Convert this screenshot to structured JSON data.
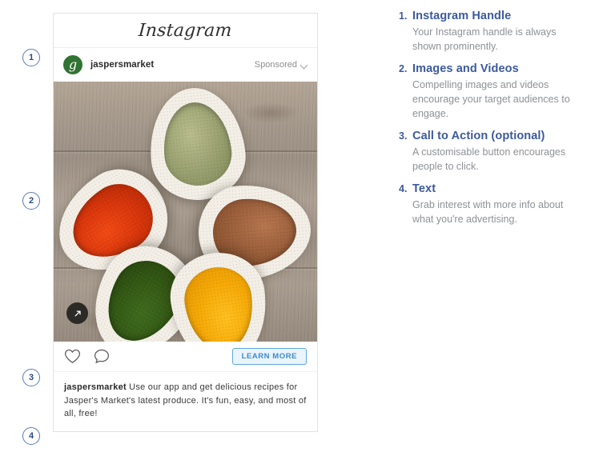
{
  "markers": [
    {
      "number": "1"
    },
    {
      "number": "2"
    },
    {
      "number": "3"
    },
    {
      "number": "4"
    }
  ],
  "card": {
    "wordmark": "Instagram",
    "avatar_letter": "g",
    "handle": "jaspersmarket",
    "sponsored_label": "Sponsored",
    "caret_icon": "chevron-down-icon",
    "photo": {
      "alt": "five teardrop bowls of colourful spices on weathered wood",
      "expand_icon": "expand-arrow-icon",
      "bowls": [
        {
          "name": "red-paprika-bowl"
        },
        {
          "name": "green-herb-bowl"
        },
        {
          "name": "brown-seed-bowl"
        },
        {
          "name": "dark-green-herb-bowl"
        },
        {
          "name": "yellow-turmeric-bowl"
        }
      ]
    },
    "actions": {
      "like_icon": "heart-icon",
      "comment_icon": "comment-bubble-icon",
      "cta_label": "LEARN MORE"
    },
    "caption": {
      "handle": "jaspersmarket",
      "text": " Use our app and get delicious recipes for Jasper's Market's latest produce. It's fun, easy, and most of all, free!"
    }
  },
  "legend": {
    "items": [
      {
        "number": "1.",
        "title": "Instagram Handle",
        "body": "Your Instagram handle is always shown prominently."
      },
      {
        "number": "2.",
        "title": "Images and Videos",
        "body": "Compelling images and videos encourage your target audiences to engage."
      },
      {
        "number": "3.",
        "title": "Call to Action (optional)",
        "body": "A customisable button encourages people to click."
      },
      {
        "number": "4.",
        "title": "Text",
        "body": "Grab interest with more info about what you're advertising."
      }
    ]
  },
  "colors": {
    "legend_heading": "#3c5a9a",
    "legend_body": "#8e9196",
    "marker_border": "#5b79b5",
    "cta_blue": "#3b8ccb",
    "avatar_green": "#317332"
  }
}
